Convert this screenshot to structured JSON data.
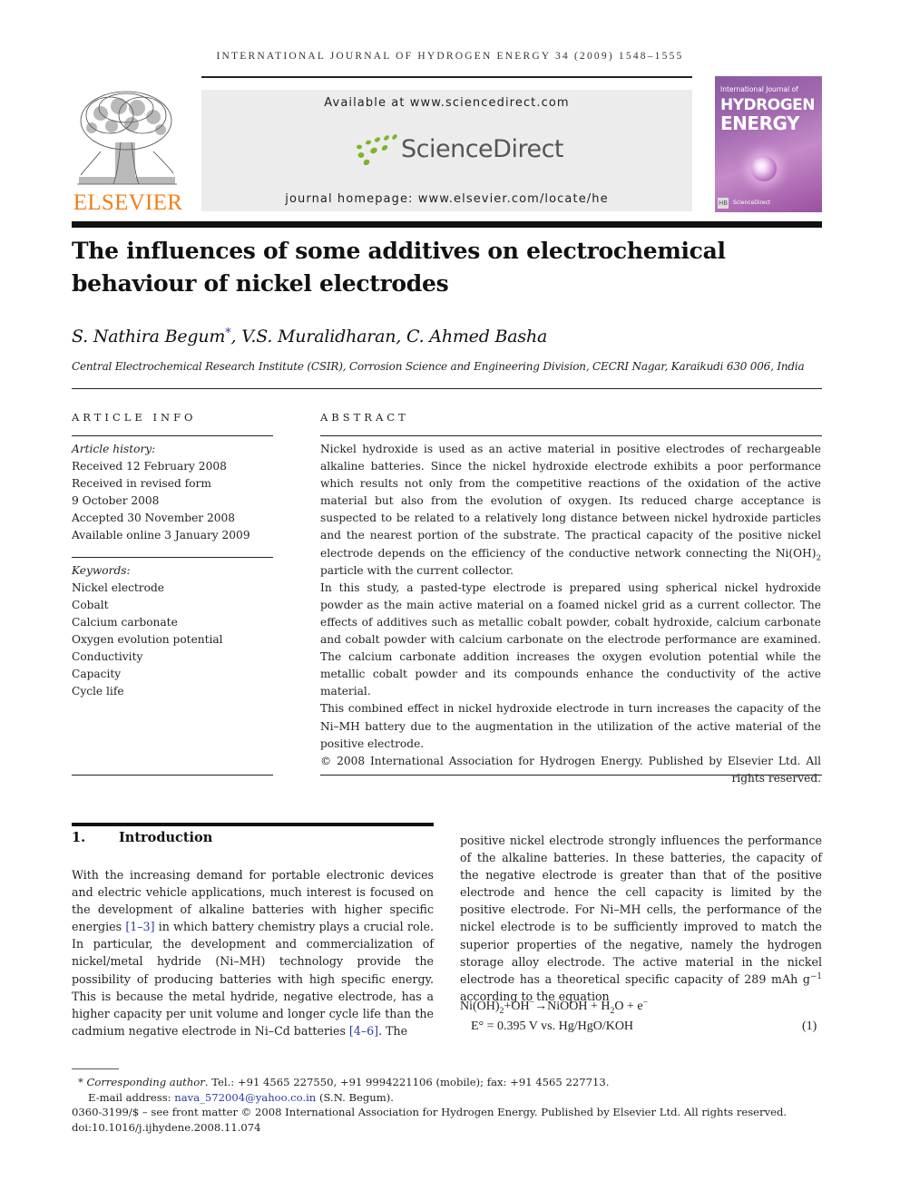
{
  "header": {
    "running_head": "INTERNATIONAL JOURNAL OF HYDROGEN ENERGY 34 (2009) 1548–1555",
    "publisher_logo_text": "ELSEVIER",
    "available_at": "Available at www.sciencedirect.com",
    "sciencedirect_brand": "ScienceDirect",
    "journal_homepage": "journal homepage: www.elsevier.com/locate/he",
    "cover": {
      "line1": "International Journal of",
      "line2": "HYDROGEN",
      "line3": "ENERGY",
      "badge": "HB",
      "footer": "ScienceDirect"
    }
  },
  "article": {
    "title_line1": "The influences of some additives on electrochemical",
    "title_line2": "behaviour of nickel electrodes",
    "authors": {
      "author1": "S. Nathira Begum",
      "author1_mark": "*",
      "rest": ", V.S. Muralidharan, C. Ahmed Basha"
    },
    "affiliation": "Central Electrochemical Research Institute (CSIR), Corrosion Science and Engineering Division, CECRI Nagar, Karaikudi 630 006, India"
  },
  "article_info": {
    "heading": "ARTICLE INFO",
    "history_label": "Article history:",
    "history": [
      "Received 12 February 2008",
      "Received in revised form",
      "9 October 2008",
      "Accepted 30 November 2008",
      "Available online 3 January 2009"
    ],
    "keywords_label": "Keywords:",
    "keywords": [
      "Nickel electrode",
      "Cobalt",
      "Calcium carbonate",
      "Oxygen evolution potential",
      "Conductivity",
      "Capacity",
      "Cycle life"
    ]
  },
  "abstract": {
    "heading": "ABSTRACT",
    "p1_a": "Nickel hydroxide is used as an active material in positive electrodes of rechargeable alkaline batteries. Since the nickel hydroxide electrode exhibits a poor performance which results not only from the competitive reactions of the oxidation of the active material but also from the evolution of oxygen. Its reduced charge acceptance is suspected to be related to a relatively long distance between nickel hydroxide particles and the nearest portion of the substrate. The practical capacity of the positive nickel electrode depends on the efficiency of the conductive network connecting the Ni(OH)",
    "p1_sub": "2",
    "p1_b": " particle with the current collector.",
    "p2": "In this study, a pasted-type electrode is prepared using spherical nickel hydroxide powder as the main active material on a foamed nickel grid as a current collector. The effects of additives such as metallic cobalt powder, cobalt hydroxide, calcium carbonate and cobalt powder with calcium carbonate on the electrode performance are examined. The calcium carbonate addition increases the oxygen evolution potential while the metallic cobalt powder and its compounds enhance the conductivity of the active material.",
    "p3": "This combined effect in nickel hydroxide electrode in turn increases the capacity of the Ni–MH battery due to the augmentation in the utilization of the active material of the positive electrode.",
    "copyright": "© 2008 International Association for Hydrogen Energy. Published by Elsevier Ltd. All rights reserved."
  },
  "introduction": {
    "number": "1.",
    "heading": "Introduction",
    "left_a": "With the increasing demand for portable electronic devices and electric vehicle applications, much interest is focused on the development of alkaline batteries with higher specific energies ",
    "ref1": "[1–3]",
    "left_b": " in which battery chemistry plays a crucial role. In particular, the development and commercialization of nickel/metal hydride (Ni–MH) technology provide the possibility of producing batteries with high specific energy. This is because the metal hydride, negative electrode, has a higher capacity per unit volume and longer cycle life than the cadmium negative electrode in Ni–Cd batteries ",
    "ref2": "[4–6]",
    "left_c": ". The",
    "right_a": "positive nickel electrode strongly influences the performance of the alkaline batteries. In these batteries, the capacity of the negative electrode is greater than that of the positive electrode and hence the cell capacity is limited by the positive electrode. For Ni–MH cells, the performance of the nickel electrode is to be sufficiently improved to match the superior properties of the negative, namely the hydrogen storage alloy electrode. The active material in the nickel electrode has a theoretical specific capacity of 289 mAh g",
    "right_sup": "−1",
    "right_b": " according to the equation",
    "equation": {
      "line1_a": "Ni(OH)",
      "line1_sub": "2",
      "line1_b": "+OH",
      "line1_sup1": "−",
      "line1_c": "→NiOOH + H",
      "line1_sub2": "2",
      "line1_d": "O + e",
      "line1_sup2": "−",
      "line2": "E° = 0.395 V vs. Hg/HgO/KOH",
      "number": "(1)"
    }
  },
  "footnotes": {
    "mark": "*",
    "corr_label": "Corresponding author",
    "corr_text": ". Tel.: +91 4565 227550, +91 9994221106 (mobile); fax: +91 4565 227713.",
    "email_label": "E-mail address: ",
    "email": "nava_572004@yahoo.co.in",
    "email_suffix": " (S.N. Begum).",
    "issn_line": "0360-3199/$ – see front matter © 2008 International Association for Hydrogen Energy. Published by Elsevier Ltd. All rights reserved.",
    "doi": "doi:10.1016/j.ijhydene.2008.11.074"
  }
}
